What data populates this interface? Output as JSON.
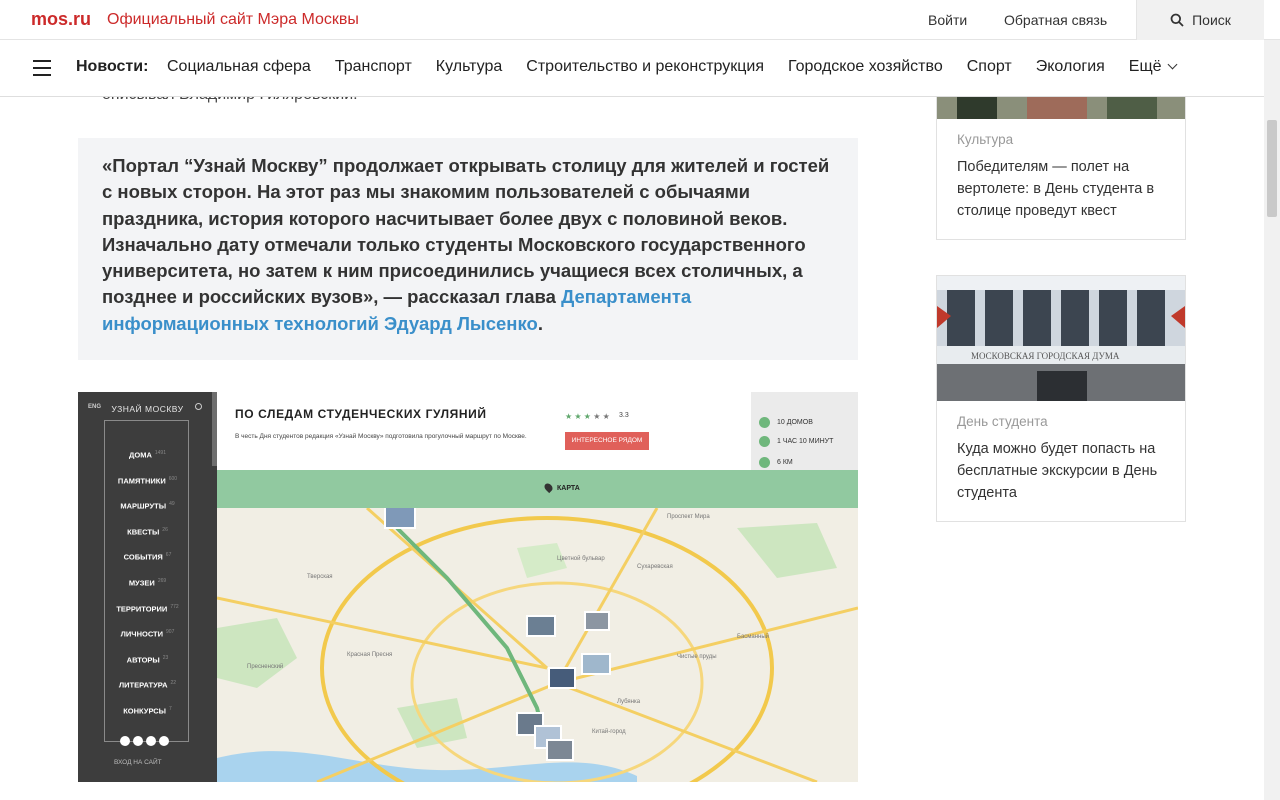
{
  "header": {
    "logo": "mos.ru",
    "site_name": "Официальный сайт Мэра Москвы",
    "login": "Войти",
    "feedback": "Обратная связь",
    "search": "Поиск"
  },
  "nav": {
    "label": "Новости:",
    "items": [
      "Социальная сфера",
      "Транспорт",
      "Культура",
      "Строительство и реконструкция",
      "Городское хозяйство",
      "Спорт",
      "Экология"
    ],
    "more": "Ещё"
  },
  "article": {
    "prev_line": "описывал Владимир Гиляровский.",
    "quote_text": "«Портал “Узнай Москву” продолжает открывать столицу для жителей и гостей с новых сторон. На этот раз мы знакомим пользователей с обычаями праздника, история которого насчитывает более двух с половиной веков. Изначально дату отмечали только студенты Московского государственного университета, но затем к ним присоединились учащиеся всех столичных, а позднее и российских вузов», — рассказал глава ",
    "quote_link": "Департамента информационных технологий Эдуард Лысенко",
    "quote_end": "."
  },
  "map_embed": {
    "lang": "ENG",
    "logo": "УЗНАЙ МОСКВУ",
    "menu": [
      {
        "label": "ДОМА",
        "count": "1491"
      },
      {
        "label": "ПАМЯТНИКИ",
        "count": "600"
      },
      {
        "label": "МАРШРУТЫ",
        "count": "49"
      },
      {
        "label": "КВЕСТЫ",
        "count": "26"
      },
      {
        "label": "СОБЫТИЯ",
        "count": "67"
      },
      {
        "label": "МУЗЕИ",
        "count": "269"
      },
      {
        "label": "ТЕРРИТОРИИ",
        "count": "772"
      },
      {
        "label": "ЛИЧНОСТИ",
        "count": "907"
      },
      {
        "label": "АВТОРЫ",
        "count": "23"
      },
      {
        "label": "ЛИТЕРАТУРА",
        "count": "22"
      },
      {
        "label": "КОНКУРСЫ",
        "count": "7"
      }
    ],
    "login": "ВХОД НА САЙТ",
    "title": "ПО СЛЕДАМ СТУДЕНЧЕСКИХ ГУЛЯНИЙ",
    "description": "В честь Дня студентов редакция «Узнай Москву» подготовила прогулочный маршрут по Москве.",
    "rating": "3.3",
    "stars": 3,
    "button": "ИНТЕРЕСНОЕ РЯДОМ",
    "stats": [
      "10 ДОМОВ",
      "1 ЧАС 10 МИНУТ",
      "6 КМ"
    ],
    "map_label": "КАРТА",
    "map_labels": [
      "Тверская",
      "Пресненский",
      "Красная Пресня",
      "Басманный",
      "Цветной бульвар",
      "Сухаревская",
      "Лубянка",
      "Китай-город",
      "Проспект Мира",
      "Чистые пруды"
    ]
  },
  "sidebar": {
    "cards": [
      {
        "category": "Культура",
        "title": "Победителям — полет на вертолете: в День студента в столице проведут квест"
      },
      {
        "category": "День студента",
        "title": "Куда можно будет попасть на бесплатные экскурсии в День студента",
        "image_caption": "МОСКОВСКАЯ ГОРОДСКАЯ ДУМА"
      }
    ]
  },
  "colors": {
    "brand_red": "#cc2a2a",
    "link_blue": "#3a8fca",
    "map_green": "#91c9a0",
    "map_button": "#e0605a"
  }
}
